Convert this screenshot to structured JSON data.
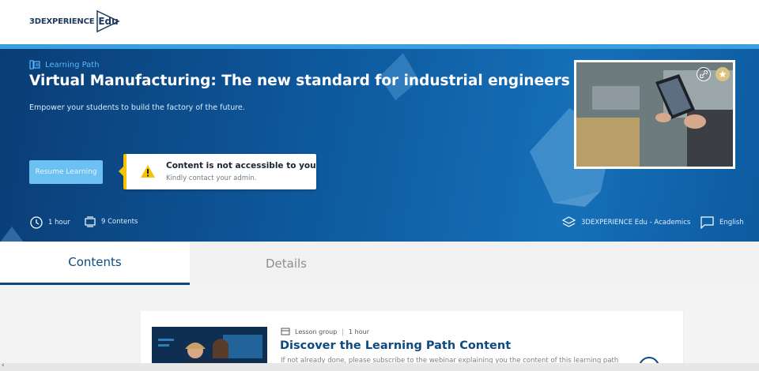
{
  "header": {
    "logo_text": "3DEXPERIENCE",
    "logo_badge": "Edu"
  },
  "hero": {
    "eyebrow": "Learning Path",
    "title": "Virtual Manufacturing: The new standard for industrial engineers",
    "subtitle": "Empower your students to build the factory of the future.",
    "resume_label": "Resume Learning",
    "alert": {
      "title": "Content is not accessible to you",
      "text": "Kindly contact your admin."
    },
    "duration": "1 hour",
    "contents_count": "9 Contents",
    "provider": "3DEXPERIENCE Edu - Academics",
    "language": "English"
  },
  "tabs": [
    {
      "label": "Contents",
      "active": true
    },
    {
      "label": "Details",
      "active": false
    }
  ],
  "content_card": {
    "type": "Lesson group",
    "duration": "1 hour",
    "title": "Discover the Learning Path Content",
    "description": "If not already done, please subscribe to the webinar explaining you the content of this learning path"
  },
  "colors": {
    "accent": "#3a9fe0",
    "brand_dark": "#0c4a80",
    "warning": "#f5c400",
    "button": "#6cc0f2"
  },
  "icons": [
    "learning-path-icon",
    "clock-icon",
    "contents-icon",
    "layers-icon",
    "chat-icon",
    "warning-icon",
    "link-icon",
    "star-icon",
    "lesson-group-icon"
  ]
}
